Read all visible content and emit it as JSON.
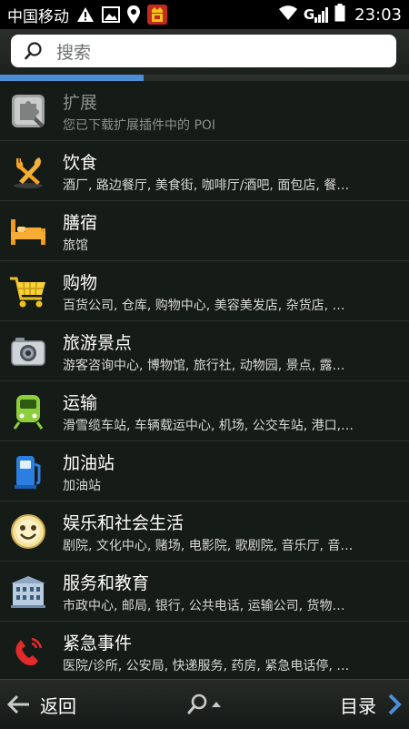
{
  "status_bar": {
    "carrier": "中国移动",
    "signal_label": "G",
    "time": "23:03"
  },
  "search": {
    "placeholder": "搜索"
  },
  "loading_progress": 0.35,
  "categories": [
    {
      "title": "扩展",
      "subtitle": "您已下载扩展插件中的 POI",
      "icon": "puzzle-extension-icon"
    },
    {
      "title": "饮食",
      "subtitle": "酒厂, 路边餐厅, 美食街, 咖啡厅/酒吧, 面包店, 餐…",
      "icon": "fork-knife-icon"
    },
    {
      "title": "膳宿",
      "subtitle": "旅馆",
      "icon": "bed-icon"
    },
    {
      "title": "购物",
      "subtitle": "百货公司, 仓库, 购物中心, 美容美发店, 杂货店, …",
      "icon": "shopping-cart-icon"
    },
    {
      "title": "旅游景点",
      "subtitle": "游客咨询中心, 博物馆, 旅行社, 动物园, 景点, 露…",
      "icon": "camera-icon"
    },
    {
      "title": "运输",
      "subtitle": "滑雪缆车站, 车辆载运中心, 机场, 公交车站, 港口,…",
      "icon": "train-icon"
    },
    {
      "title": "加油站",
      "subtitle": "加油站",
      "icon": "fuel-pump-icon"
    },
    {
      "title": "娱乐和社会生活",
      "subtitle": "剧院, 文化中心, 赌场, 电影院, 歌剧院, 音乐厅, 音…",
      "icon": "smiley-icon"
    },
    {
      "title": "服务和教育",
      "subtitle": "市政中心, 邮局, 银行, 公共电话, 运输公司, 货物…",
      "icon": "building-icon"
    },
    {
      "title": "紧急事件",
      "subtitle": "医院/诊所, 公安局, 快递服务, 药房, 紧急电话停, …",
      "icon": "emergency-phone-icon"
    }
  ],
  "bottom_bar": {
    "back_label": "返回",
    "menu_label": "目录"
  },
  "colors": {
    "accent": "#4d8ed8",
    "background": "#151b17"
  }
}
